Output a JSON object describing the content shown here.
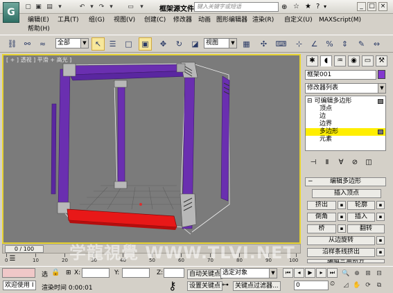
{
  "title": {
    "filename": "框架源文件.max",
    "search_placeholder": "键入关键字或短语",
    "app_logo_letter": "G"
  },
  "menu": {
    "items": [
      "编辑(E)",
      "工具(T)",
      "组(G)",
      "视图(V)",
      "创建(C)",
      "修改器",
      "动画",
      "图形编辑器",
      "渲染(R)",
      "自定义(U)",
      "MAXScript(M)"
    ],
    "help": "帮助(H)"
  },
  "toolbar": {
    "selection_filter": "全部",
    "ref_coord": "视图"
  },
  "viewport": {
    "label": "[ + ] 透视 ] 平滑 + 高光 ]"
  },
  "panel": {
    "object_name": "框架001",
    "object_color": "#8338ce",
    "modifier_list": "修改器列表",
    "stack": [
      {
        "label": "可编辑多边形",
        "indent": 0,
        "expand": "⊟"
      },
      {
        "label": "顶点",
        "indent": 1
      },
      {
        "label": "边",
        "indent": 1
      },
      {
        "label": "边界",
        "indent": 1
      },
      {
        "label": "多边形",
        "indent": 1,
        "selected": true
      },
      {
        "label": "元素",
        "indent": 1
      }
    ],
    "rollout_title": "编辑多边形",
    "buttons": {
      "insert_vertex": "插入顶点",
      "extrude": "挤出",
      "outline": "轮廓",
      "bevel": "倒角",
      "inset": "插入",
      "bridge": "桥",
      "flip": "翻转",
      "hinge": "从边旋转",
      "extrude_spline": "沿样条线挤出",
      "edit_tri": "编辑三角剖分"
    }
  },
  "timeline": {
    "frame": "0 / 100",
    "ticks": [
      "0",
      "10",
      "20",
      "30",
      "40",
      "50",
      "60",
      "70",
      "80",
      "90",
      "100"
    ]
  },
  "status": {
    "welcome": "欢迎使用 I",
    "select_label": "选",
    "x_label": "X:",
    "y_label": "Y:",
    "z_label": "Z:",
    "render_time": "渲染时间  0:00:01",
    "auto_key": "自动关键点",
    "set_key": "设置关键点",
    "selected_object": "选定对象",
    "key_filters": "关键点过滤器...",
    "frame_value": "0"
  },
  "watermark": "学龍視覺 WWW.TLVI.NET",
  "colors": {
    "viewport_border": "#e8d430",
    "frame_purple": "#6a2fb0",
    "highlight_red": "#e81818"
  }
}
